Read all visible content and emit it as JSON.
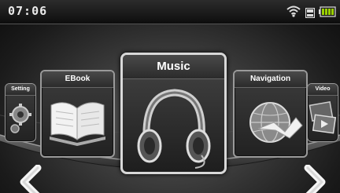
{
  "status_bar": {
    "time": "07:06",
    "icons": [
      "wifi-icon",
      "storage-icon",
      "battery-icon"
    ]
  },
  "menu": {
    "items": [
      {
        "label": "Setting",
        "icon": "setting-icon"
      },
      {
        "label": "EBook",
        "icon": "open-book-icon"
      },
      {
        "label": "Music",
        "icon": "headphones-icon",
        "selected": true
      },
      {
        "label": "Navigation",
        "icon": "globe-arrow-icon"
      },
      {
        "label": "Video",
        "icon": "video-icon"
      }
    ]
  },
  "navigation": {
    "prev_icon": "chevron-left-icon",
    "next_icon": "chevron-right-icon"
  },
  "colors": {
    "background": "#3a3a3a",
    "card_border_selected": "#d8d8d8",
    "text": "#ffffff"
  }
}
